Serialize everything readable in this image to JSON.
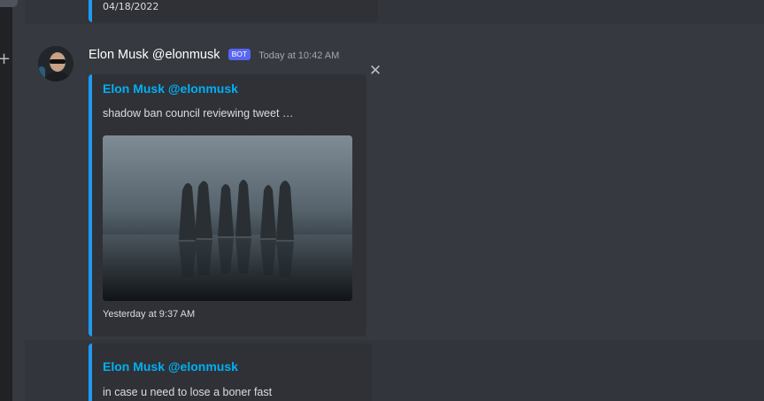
{
  "previous_embed": {
    "date": "04/18/2022"
  },
  "message": {
    "author": "Elon Musk @elonmusk",
    "badge": "BOT",
    "timestamp": "Today at 10:42 AM",
    "avatar_icon": "avatar-photo"
  },
  "embed": {
    "title": "Elon Musk @elonmusk",
    "description": "shadow ban council reviewing tweet …",
    "image_icon": "hooded-figures-photo",
    "footer": "Yesterday at 9:37 AM",
    "accent_color": "#1d9bf0",
    "close_glyph": "✕"
  },
  "next_embed": {
    "title": "Elon Musk @elonmusk",
    "description": "in case u need to lose a boner fast"
  },
  "sidebar": {
    "add_glyph": "+"
  },
  "colors": {
    "background": "#36393f",
    "embed_background": "#2f3136",
    "link": "#00b0f4",
    "badge": "#5865f2"
  }
}
